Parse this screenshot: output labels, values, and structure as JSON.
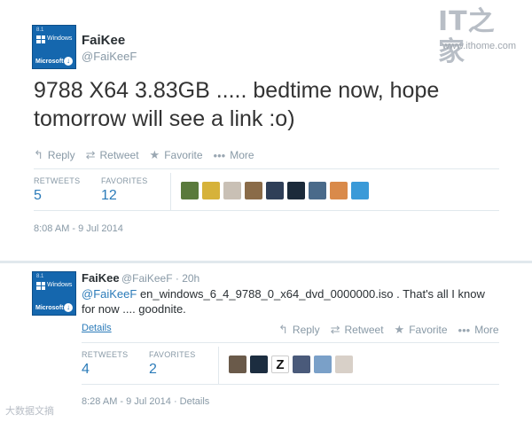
{
  "watermark": {
    "logo": "IT之家",
    "url": "www.ithome.com"
  },
  "avatar": {
    "version": "8.1",
    "windows": "Windows",
    "microsoft": "Microsoft"
  },
  "tweet": {
    "name": "FaiKee",
    "handle": "@FaiKeeF",
    "text": "9788 X64 3.83GB ..... bedtime now, hope tomorrow will see a link :o)",
    "actions": {
      "reply": "Reply",
      "retweet": "Retweet",
      "favorite": "Favorite",
      "more": "More"
    },
    "stats": {
      "retweets_label": "RETWEETS",
      "retweets": "5",
      "favorites_label": "FAVORITES",
      "favorites": "12"
    },
    "favoriters": [
      "#5a7a3c",
      "#d6b23a",
      "#c9c0b5",
      "#8a6b48",
      "#2f3f58",
      "#1b2a3a",
      "#4a6a8a",
      "#d98a4a",
      "#3a9ad8"
    ],
    "timestamp": "8:08 AM - 9 Jul 2014"
  },
  "reply": {
    "name": "FaiKee",
    "handle_time": "@FaiKeeF · 20h",
    "mention": "@FaiKeeF",
    "text": " en_windows_6_4_9788_0_x64_dvd_0000000.iso . That's all I know for now .... goodnite.",
    "details": "Details",
    "actions": {
      "reply": "Reply",
      "retweet": "Retweet",
      "favorite": "Favorite",
      "more": "More"
    },
    "stats": {
      "retweets_label": "RETWEETS",
      "retweets": "4",
      "favorites_label": "FAVORITES",
      "favorites": "2"
    },
    "favoriters": [
      "#6a5a4a",
      "#1c2d40",
      "#ffffff",
      "#4a5a7a",
      "#7aa0c8",
      "#d8d0c8"
    ],
    "z_glyph": "Z",
    "timestamp": "8:28 AM - 9 Jul 2014 · Details"
  },
  "footer_watermark": "大数据文摘"
}
